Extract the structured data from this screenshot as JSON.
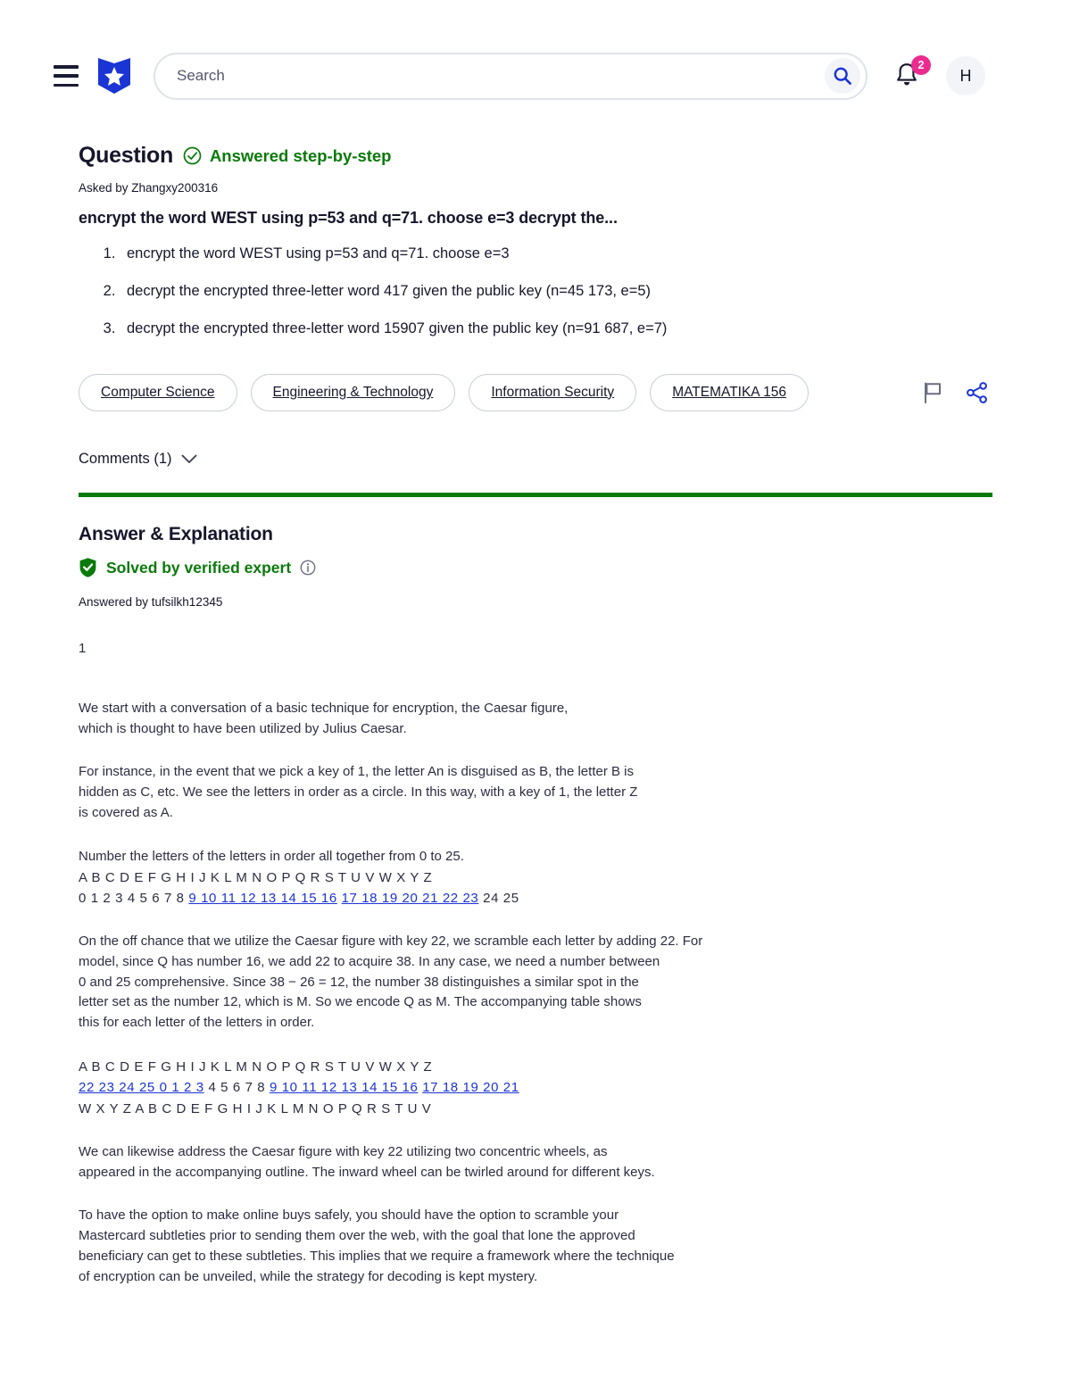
{
  "header": {
    "menu_icon": "hamburger-menu-icon",
    "logo_icon": "coursehero-shield-star-logo",
    "search": {
      "placeholder": "Search",
      "value": "",
      "search_icon": "search-icon"
    },
    "notifications": {
      "bell_icon": "bell-icon",
      "count": "2",
      "badge_color": "#eb2b8f"
    },
    "avatar": {
      "initial": "H"
    }
  },
  "question": {
    "label": "Question",
    "status": "Answered step-by-step",
    "status_icon": "check-circle-icon",
    "status_color": "#0a7a0a",
    "asked_by": "Asked by Zhangxy200316",
    "title": "encrypt the word WEST using p=53 and q=71. choose e=3 decrypt the...",
    "items": [
      "encrypt the word WEST using p=53 and q=71. choose e=3",
      "decrypt the encrypted three-letter word 417 given the public key (n=45 173, e=5)",
      "decrypt the encrypted three-letter word 15907 given the public key (n=91 687, e=7)"
    ],
    "tags": [
      "Computer Science",
      "Engineering & Technology",
      "Information Security",
      "MATEMATIKA 156"
    ],
    "actions": {
      "flag_icon": "flag-icon",
      "share_icon": "share-icon"
    },
    "comments_label": "Comments (1)",
    "comments_chevron": "chevron-down-icon"
  },
  "answer": {
    "heading": "Answer & Explanation",
    "verified_label": "Solved by verified expert",
    "verified_icon": "shield-check-icon",
    "info_icon": "info-circle-icon",
    "verified_color": "#0a7a0a",
    "answered_by": "Answered by tufsilkh12345",
    "part_number": "1",
    "paragraphs": [
      "We start with a conversation of a basic technique for encryption, the Caesar figure,\nwhich is thought to have been utilized by Julius Caesar.",
      "For instance, in the event that we pick a key of 1, the letter An is disguised as B, the letter B is\nhidden as C, etc. We see the letters in order as a circle. In this way, with a key of 1, the letter Z\nis covered as A.",
      "Number the letters of the letters in order all together from 0 to 25."
    ],
    "table1": {
      "letters": "A B C D E F G H I J K L M N O P Q R S T U V W X Y Z",
      "numbers_plain_start": "0 1 2 3 4 5 6 7 8 ",
      "numbers_link_1": "9 10 11 12 13 14 15 16",
      "numbers_gap": " ",
      "numbers_link_2": "17 18 19 20 21 22 23",
      "numbers_plain_end": " 24 25"
    },
    "paragraph_mid": "On the off chance that we utilize the Caesar figure with key 22, we scramble each letter by adding 22. For\nmodel, since Q has number 16, we add 22 to acquire 38. In any case, we need a number between\n0 and 25 comprehensive. Since 38 − 26 = 12, the number 38 distinguishes a similar spot in the\nletter set as the number 12, which is M. So we encode Q as M. The accompanying table shows\nthis for each letter of the letters in order.",
    "table2": {
      "letters": "A B C D E F G H I J K L M N O P Q R S T U V W X Y Z",
      "numbers_link_1": "22 23 24 25 0 1 2 3",
      "numbers_plain_mid": " 4 5 6 7 8 ",
      "numbers_link_2": "9 10 11 12 13 14 15 16",
      "numbers_gap": " ",
      "numbers_link_3": "17 18 19 20 21",
      "cipher_letters": "W X Y Z A B C D E F G H I J K L M N O P Q R S T U V"
    },
    "paragraphs_end": [
      "We can likewise address the Caesar figure with key 22 utilizing two concentric wheels, as\nappeared in the accompanying outline. The inward wheel can be twirled around for different keys.",
      "To have the option to make online buys safely, you should have the option to scramble your\nMastercard subtleties prior to sending them over the web, with the goal that lone the approved\nbeneficiary can get to these subtleties. This implies that we require a framework where the technique\nof encryption can be unveiled, while the strategy for decoding is kept mystery."
    ]
  },
  "colors": {
    "brand_blue": "#1b34d4",
    "green": "#0a7a0a",
    "pink": "#eb2b8f",
    "text": "#15162b"
  }
}
